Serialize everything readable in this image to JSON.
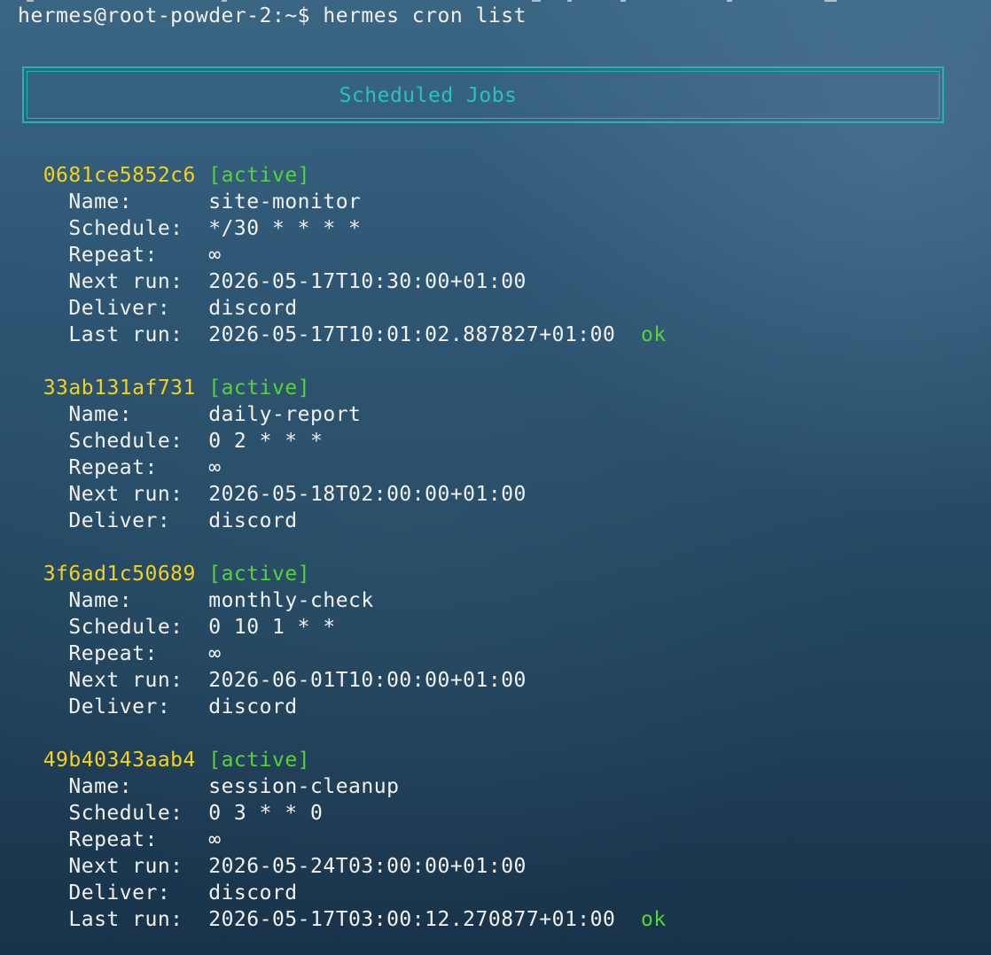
{
  "prompt": {
    "user_host": "hermes@root-powder-2:~$",
    "command": "hermes cron list"
  },
  "banner": {
    "title": "Scheduled Jobs"
  },
  "labels": {
    "name": "Name:",
    "schedule": "Schedule:",
    "repeat": "Repeat:",
    "next_run": "Next run:",
    "deliver": "Deliver:",
    "last_run": "Last run:"
  },
  "colors": {
    "job_id": "#f2d21c",
    "status": "#55d43a",
    "banner": "#26c4bd",
    "text": "#f2f2f2"
  },
  "jobs": [
    {
      "id": "0681ce5852c6",
      "status": "[active]",
      "name": "site-monitor",
      "schedule": "*/30 * * * *",
      "repeat": "∞",
      "next_run": "2026-05-17T10:30:00+01:00",
      "deliver": "discord",
      "last_run": "2026-05-17T10:01:02.887827+01:00",
      "last_status": "ok"
    },
    {
      "id": "33ab131af731",
      "status": "[active]",
      "name": "daily-report",
      "schedule": "0 2 * * *",
      "repeat": "∞",
      "next_run": "2026-05-18T02:00:00+01:00",
      "deliver": "discord"
    },
    {
      "id": "3f6ad1c50689",
      "status": "[active]",
      "name": "monthly-check",
      "schedule": "0 10 1 * *",
      "repeat": "∞",
      "next_run": "2026-06-01T10:00:00+01:00",
      "deliver": "discord"
    },
    {
      "id": "49b40343aab4",
      "status": "[active]",
      "name": "session-cleanup",
      "schedule": "0 3 * * 0",
      "repeat": "∞",
      "next_run": "2026-05-24T03:00:00+01:00",
      "deliver": "discord",
      "last_run": "2026-05-17T03:00:12.270877+01:00",
      "last_status": "ok"
    }
  ]
}
